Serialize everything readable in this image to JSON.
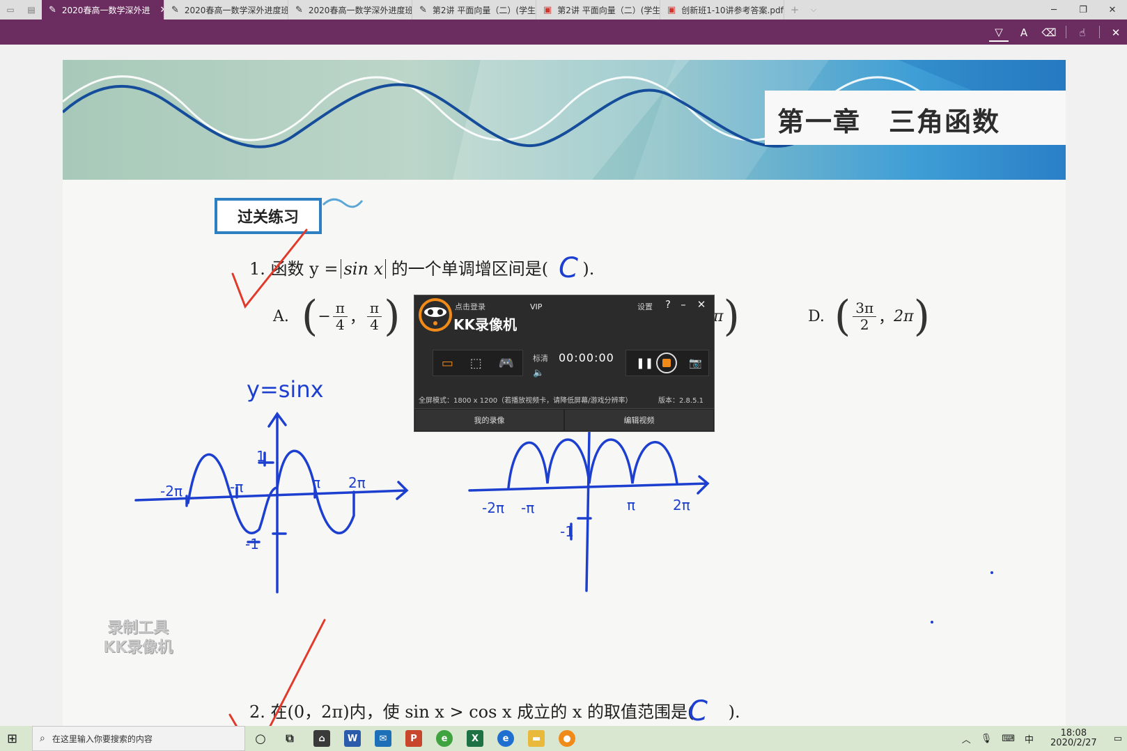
{
  "browser": {
    "tabs": [
      {
        "label": "2020春高一数学深外进",
        "icon": "pen-icon",
        "active": true
      },
      {
        "label": "2020春高一数学深外进度班",
        "icon": "pen-icon"
      },
      {
        "label": "2020春高一数学深外进度班",
        "icon": "pen-icon"
      },
      {
        "label": "第2讲 平面向量（二）(学生",
        "icon": "pen-icon"
      },
      {
        "label": "第2讲 平面向量（二）(学生",
        "icon": "pdf-icon"
      },
      {
        "label": "创新班1-10讲参考答案.pdf",
        "icon": "pdf-icon"
      }
    ],
    "accent": "#6b2d5f"
  },
  "document": {
    "chapter_title": "第一章　三角函数",
    "section_label": "过关练习",
    "q1": {
      "number": "1.",
      "text_before": "函数 y =",
      "abs_expr": "sin x",
      "text_after": "的一个单调增区间是(",
      "close": ").",
      "handwritten_answer": "C"
    },
    "q1_options": {
      "a_label": "A.",
      "a_num1": "π",
      "a_den1": "4",
      "a_sign1": "−",
      "a_num2": "π",
      "a_den2": "4",
      "c_tail": "π",
      "d_label": "D.",
      "d_num1": "3π",
      "d_den1": "2",
      "d_second": "2π"
    },
    "q2": {
      "number": "2.",
      "text": "在(0，2π)内，使 sin x > cos x 成立的 x 的取值范围是(",
      "close": ").",
      "handwritten_answer": "C"
    },
    "handwriting": {
      "label_y_sinx": "y=sinx",
      "left_graph_labels": [
        "-2π",
        "-π",
        "π",
        "2π",
        "1",
        "-1"
      ],
      "right_graph_labels": [
        "-2π",
        "-π",
        "π",
        "2π",
        "-1"
      ]
    }
  },
  "recorder": {
    "login": "点击登录",
    "vip": "VIP",
    "title": "KK录像机",
    "settings": "设置",
    "help": "?",
    "quality": "标清",
    "time": "00:00:00",
    "info": "全屏模式：1800 x 1200（若播放视频卡，请降低屏幕/游戏分辨率）",
    "version": "版本：2.8.5.1",
    "my_videos": "我的录像",
    "edit_video": "编辑视频",
    "watermark_line1": "录制工具",
    "watermark_line2": "KK录像机"
  },
  "taskbar": {
    "search_placeholder": "在这里输入你要搜索的内容",
    "ime": "中",
    "time": "18:08",
    "date": "2020/2/27"
  }
}
